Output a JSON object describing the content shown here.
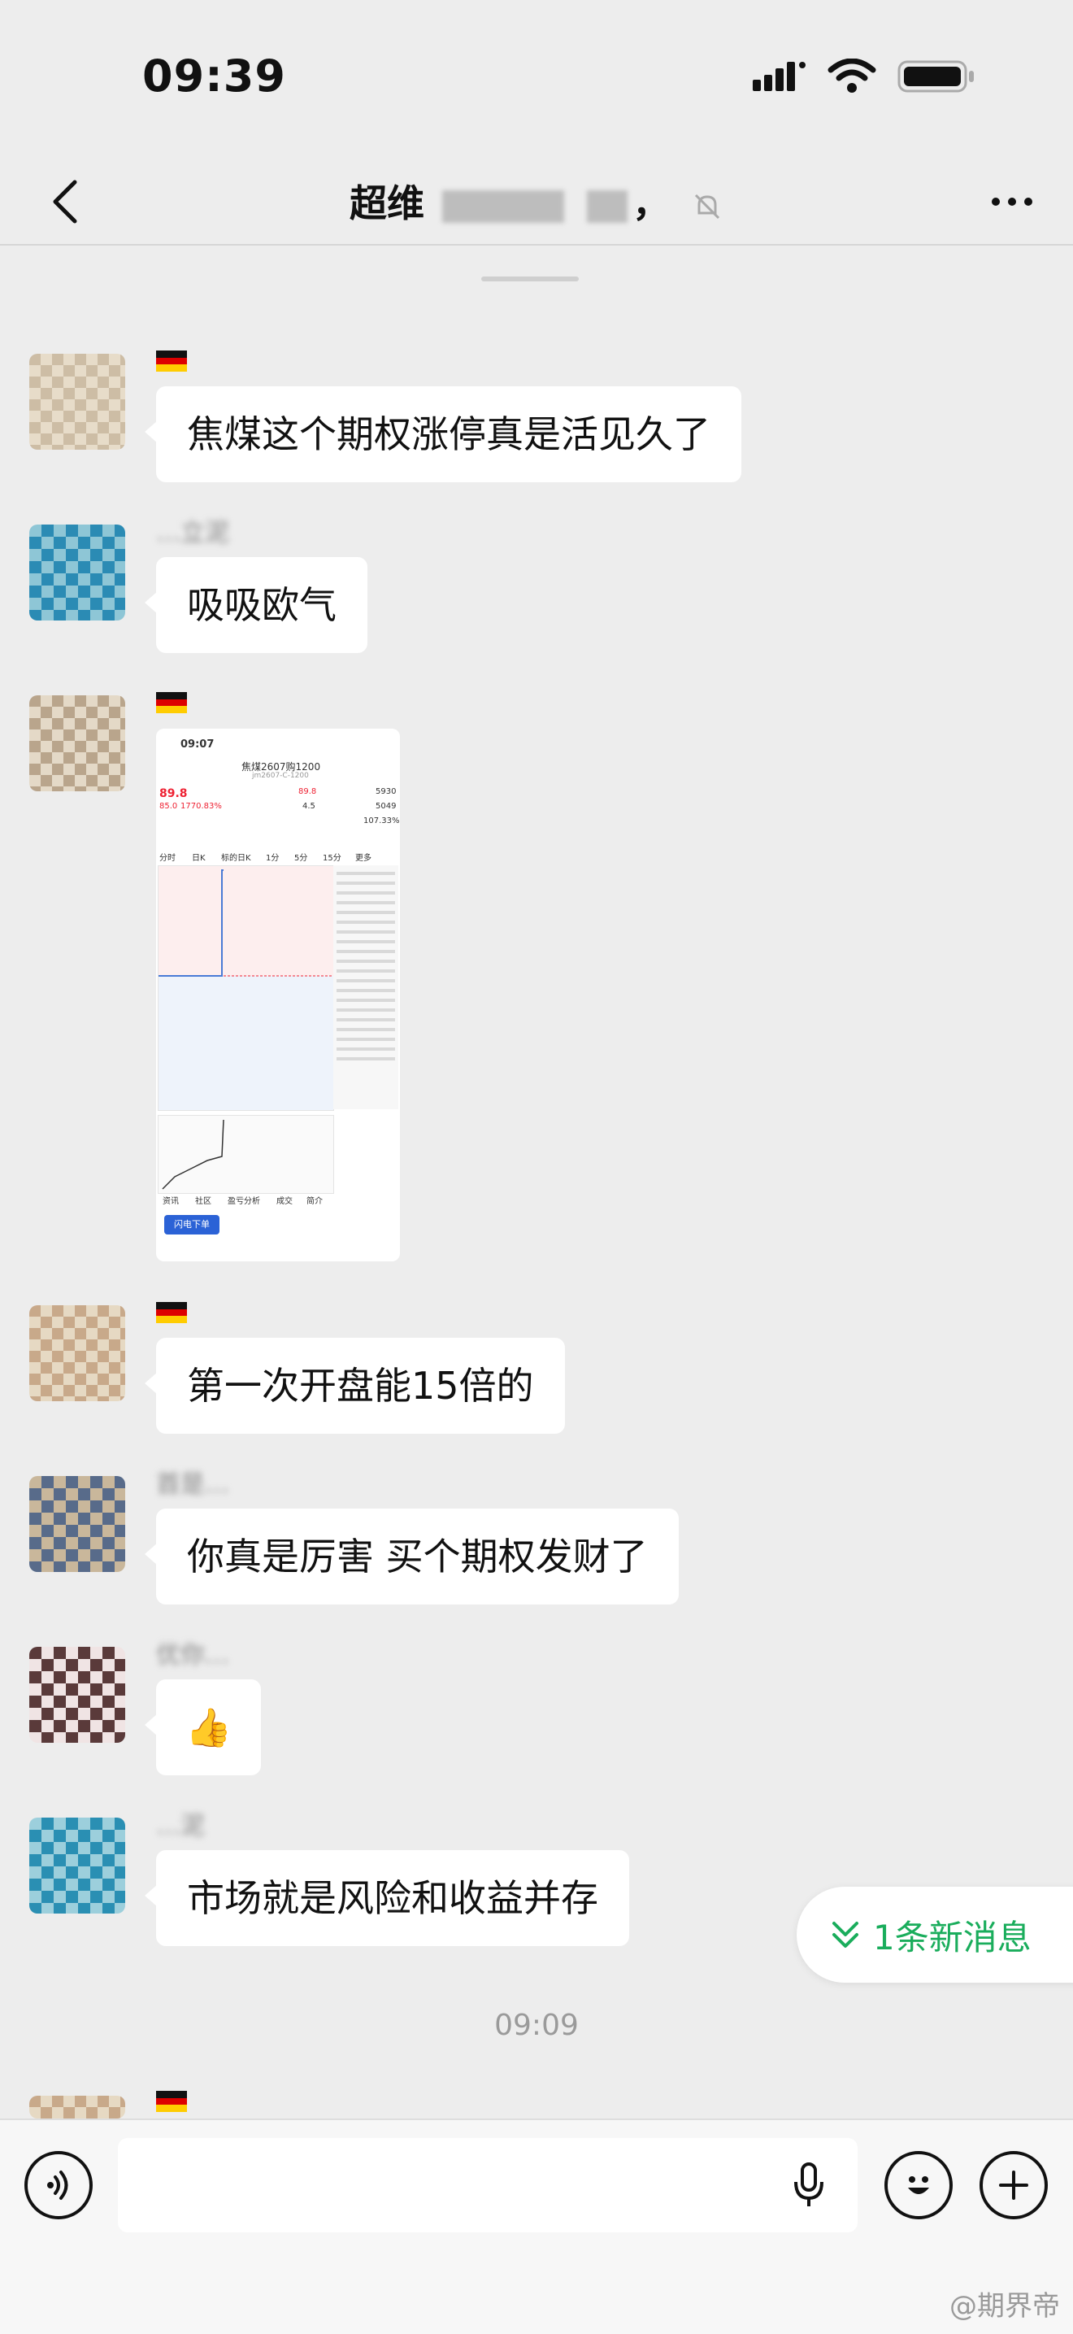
{
  "status_bar": {
    "time": "09:39"
  },
  "header": {
    "title_visible_start": "超",
    "title_visible_mid": "维",
    "title_visible_end": "，"
  },
  "messages": [
    {
      "sender": "",
      "text": "焦煤这个期权涨停真是活见久了"
    },
    {
      "sender": "…立泥",
      "text": "吸吸欧气"
    },
    {
      "sender": "",
      "type": "image"
    },
    {
      "sender": "",
      "text": "第一次开盘能15倍的"
    },
    {
      "sender": "首是…",
      "text": "你真是厉害  买个期权发财了"
    },
    {
      "sender": "优你…",
      "text": "👍"
    },
    {
      "sender": "…泥",
      "text": "市场就是风险和收益并存"
    }
  ],
  "image_message": {
    "time": "09:07",
    "title": "焦煤2607购1200",
    "code": "jm2607-C-1200",
    "last": "89.8",
    "change": "85.0",
    "pct": "1770.83%",
    "open": "89.8",
    "low": "4.5",
    "vol": "5930",
    "oi": "5049",
    "ratio": "107.33%",
    "tabs": [
      "分时",
      "日K",
      "标的日K",
      "1分",
      "5分",
      "15分",
      "更多"
    ],
    "bottom_tabs": [
      "资讯",
      "社区",
      "盈亏分析",
      "成交",
      "简介"
    ],
    "order_button": "闪电下单"
  },
  "time_divider": "09:09",
  "new_message_pill": "1条新消息",
  "watermark": "@期界帝",
  "colors": {
    "accent_green": "#1aad5c",
    "bg": "#ededed",
    "bubble": "#ffffff"
  }
}
